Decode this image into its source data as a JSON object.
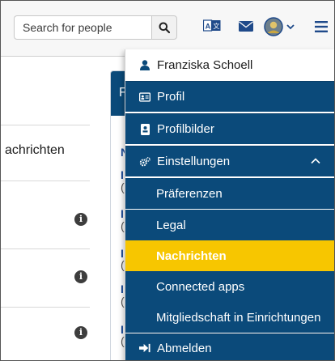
{
  "search": {
    "placeholder": "Search for people"
  },
  "navbar": {
    "icons": [
      "search-icon",
      "translate-icon",
      "envelope-icon",
      "avatar",
      "chevron-down-icon",
      "menu-icon"
    ],
    "background": "#f7f7f7"
  },
  "background_page": {
    "left_heading": "achrichten",
    "panel_heading": "F"
  },
  "user_menu": {
    "username": "Franziska Schoell",
    "items": [
      {
        "label": "Profil",
        "icon": "id-card-icon"
      },
      {
        "label": "Profilbilder",
        "icon": "portrait-icon"
      },
      {
        "label": "Einstellungen",
        "icon": "cogs-icon"
      },
      {
        "label": "Präferenzen"
      },
      {
        "label": "Legal"
      },
      {
        "label": "Nachrichten"
      },
      {
        "label": "Connected apps"
      },
      {
        "label": "Mitgliedschaft in Einrichtungen"
      },
      {
        "label": "Abmelden",
        "icon": "sign-out-icon"
      }
    ]
  },
  "colors": {
    "menu_dark": "#0b4a7a",
    "active": "#f7c600",
    "panel_header": "#0b4a7a"
  }
}
